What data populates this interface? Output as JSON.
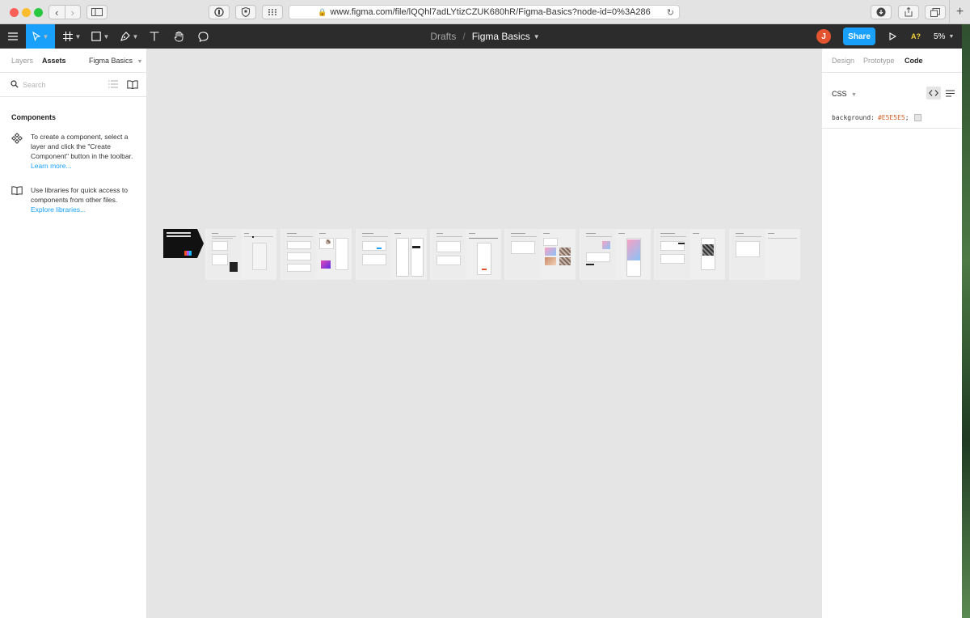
{
  "browser": {
    "url": "www.figma.com/file/lQQhl7adLYtizCZUK680hR/Figma-Basics?node-id=0%3A286"
  },
  "toolbar": {
    "breadcrumb": "Drafts",
    "separator": "/",
    "file_name": "Figma Basics",
    "avatar_initial": "J",
    "share_label": "Share",
    "a11y_label": "A?",
    "zoom": "5%"
  },
  "left_panel": {
    "tabs": [
      {
        "label": "Layers",
        "active": false
      },
      {
        "label": "Assets",
        "active": true
      }
    ],
    "page_selector": "Figma Basics",
    "search_placeholder": "Search",
    "section_title": "Components",
    "info_items": [
      {
        "icon": "component-icon",
        "text": "To create a component, select a layer and click the \"Create Component\" button in the toolbar.",
        "link": "Learn more..."
      },
      {
        "icon": "library-book-icon",
        "text": "Use libraries for quick access to components from other files.",
        "link": "Explore libraries..."
      }
    ]
  },
  "right_panel": {
    "tabs": [
      {
        "label": "Design",
        "active": false
      },
      {
        "label": "Prototype",
        "active": false
      },
      {
        "label": "Code",
        "active": true
      }
    ],
    "language": "CSS",
    "code_property": "background:",
    "code_value": "#E5E5E5",
    "code_suffix": ";",
    "swatch_color": "#E5E5E5"
  },
  "canvas": {
    "background": "#E5E5E5",
    "frame_count": 8
  },
  "help_label": "?"
}
